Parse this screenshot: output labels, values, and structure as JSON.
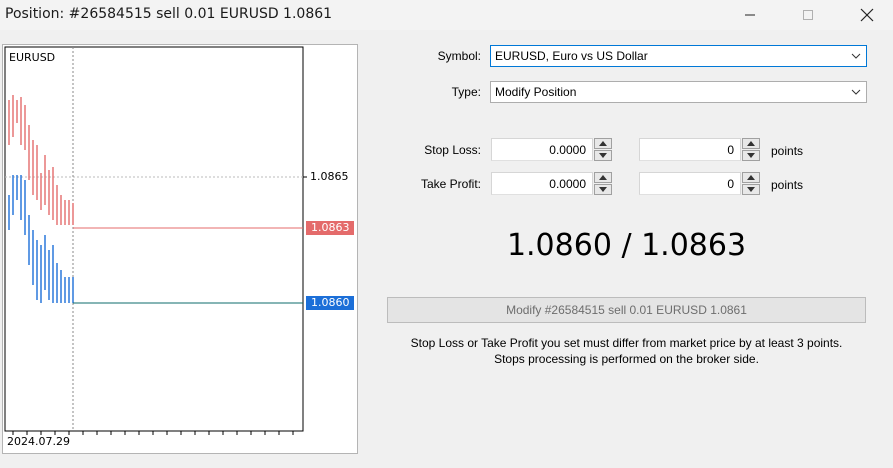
{
  "window": {
    "title": "Position: #26584515 sell 0.01 EURUSD 1.0861",
    "controls": [
      "minimize-icon",
      "maximize-icon",
      "close-icon"
    ]
  },
  "chart": {
    "symbol": "EURUSD",
    "price_tick": "1.0865",
    "ask_label": "1.0863",
    "bid_label": "1.0860",
    "date_label": "2024.07.29",
    "colors": {
      "ask": "#e46b6b",
      "bid": "#1c6fd8",
      "ask_line": "#e46b6b",
      "bid_line": "#0e6b6b"
    }
  },
  "form": {
    "symbol_label": "Symbol:",
    "symbol_value": "EURUSD, Euro vs US Dollar",
    "type_label": "Type:",
    "type_value": "Modify Position",
    "stop_loss_label": "Stop Loss:",
    "stop_loss_price": "0.0000",
    "stop_loss_points": "0",
    "take_profit_label": "Take Profit:",
    "take_profit_price": "0.0000",
    "take_profit_points": "0",
    "points_unit": "points"
  },
  "quote": "1.0860 / 1.0863",
  "modify_button": "Modify #26584515 sell 0.01 EURUSD 1.0861",
  "note": {
    "line1": "Stop Loss or Take Profit you set must differ from market price by at least 3 points.",
    "line2": "Stops processing is performed on the broker side."
  }
}
